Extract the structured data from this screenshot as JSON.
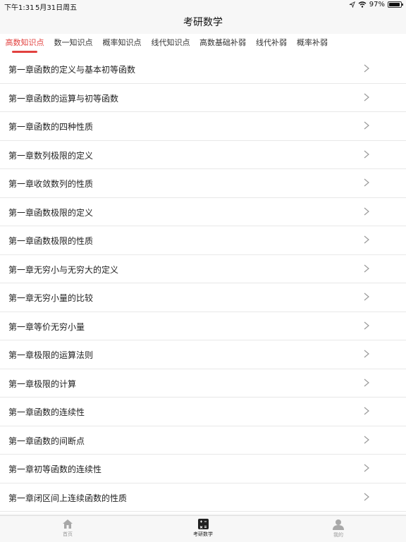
{
  "status": {
    "time": "下午1:31",
    "date": "5月31日周五",
    "battery_text": "97%",
    "battery_level": 0.97
  },
  "nav": {
    "title": "考研数学"
  },
  "tabs": [
    {
      "label": "高数知识点",
      "active": true
    },
    {
      "label": "数一知识点",
      "active": false
    },
    {
      "label": "概率知识点",
      "active": false
    },
    {
      "label": "线代知识点",
      "active": false
    },
    {
      "label": "高数基础补弱",
      "active": false
    },
    {
      "label": "线代补弱",
      "active": false
    },
    {
      "label": "概率补弱",
      "active": false
    }
  ],
  "list": {
    "items": [
      "第一章函数的定义与基本初等函数",
      "第一章函数的运算与初等函数",
      "第一章函数的四种性质",
      "第一章数列极限的定义",
      "第一章收敛数列的性质",
      "第一章函数极限的定义",
      "第一章函数极限的性质",
      "第一章无穷小与无穷大的定义",
      "第一章无穷小量的比较",
      "第一章等价无穷小量",
      "第一章极限的运算法则",
      "第一章极限的计算",
      "第一章函数的连续性",
      "第一章函数的间断点",
      "第一章初等函数的连续性",
      "第一章闭区间上连续函数的性质"
    ]
  },
  "tabbar": {
    "home": "首页",
    "math": "考研数学",
    "mine": "我的"
  },
  "colors": {
    "accent": "#e2413f",
    "chevron": "#9a9a9a",
    "tab_inactive": "#9a9a9a"
  }
}
